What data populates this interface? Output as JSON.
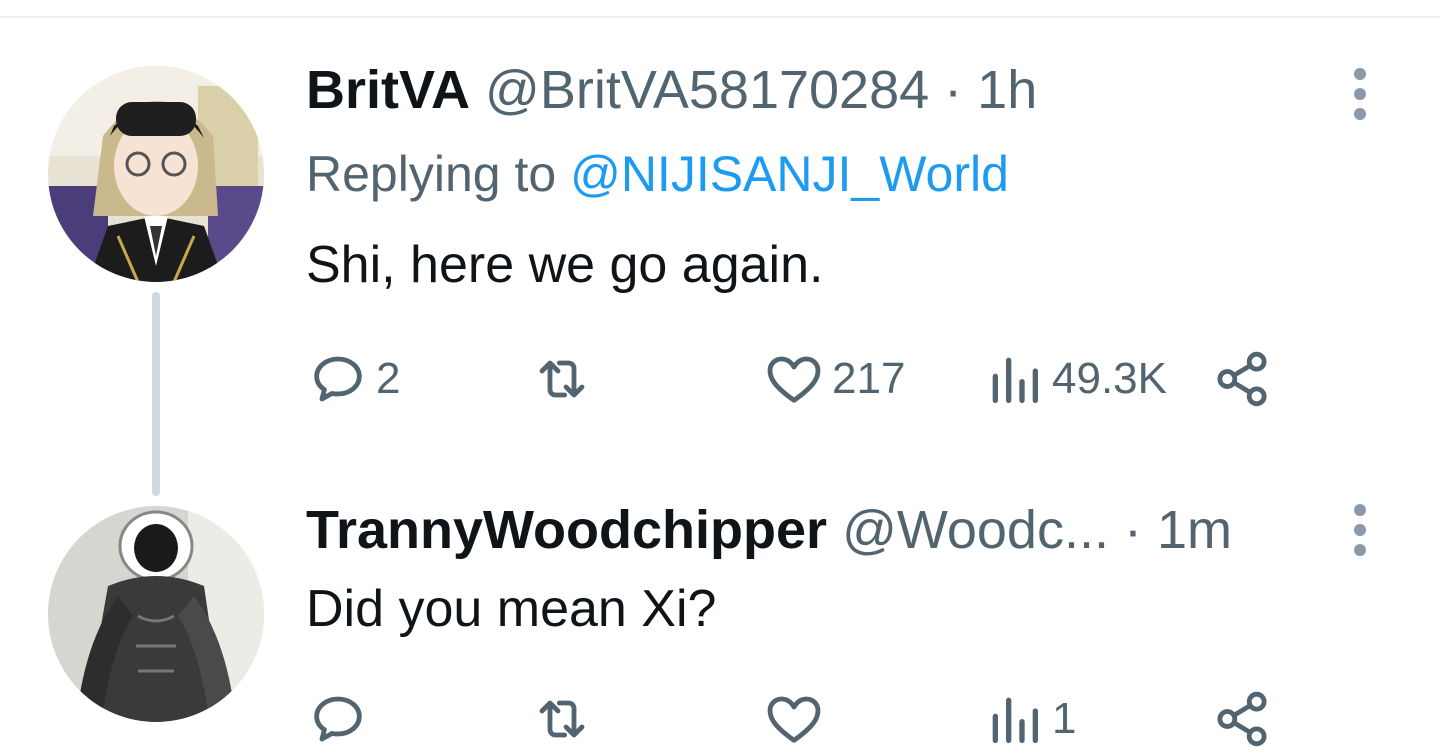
{
  "tweets": [
    {
      "name": "BritVA",
      "handle": "@BritVA58170284",
      "separator": "·",
      "time": "1h",
      "replying_prefix": "Replying to",
      "replying_to": "@NIJISANJI_World",
      "text": "Shi, here we go again.",
      "replies": "2",
      "retweets": "",
      "likes": "217",
      "views": "49.3K",
      "avatar_icon": "anime-character-avatar"
    },
    {
      "name": "TrannyWoodchipper",
      "handle": "@Woodc...",
      "separator": "·",
      "time": "1m",
      "text": "Did you mean Xi?",
      "replies": "",
      "retweets": "",
      "likes": "",
      "views": "1",
      "avatar_icon": "muscular-figure-avatar"
    }
  ],
  "icons": {
    "reply": "reply-icon",
    "retweet": "retweet-icon",
    "like": "like-icon",
    "views": "views-icon",
    "share": "share-icon",
    "more": "more-icon"
  },
  "colors": {
    "text": "#0f1419",
    "secondary": "#536471",
    "link": "#1d9bf0",
    "thread_line": "#cfd9de"
  }
}
